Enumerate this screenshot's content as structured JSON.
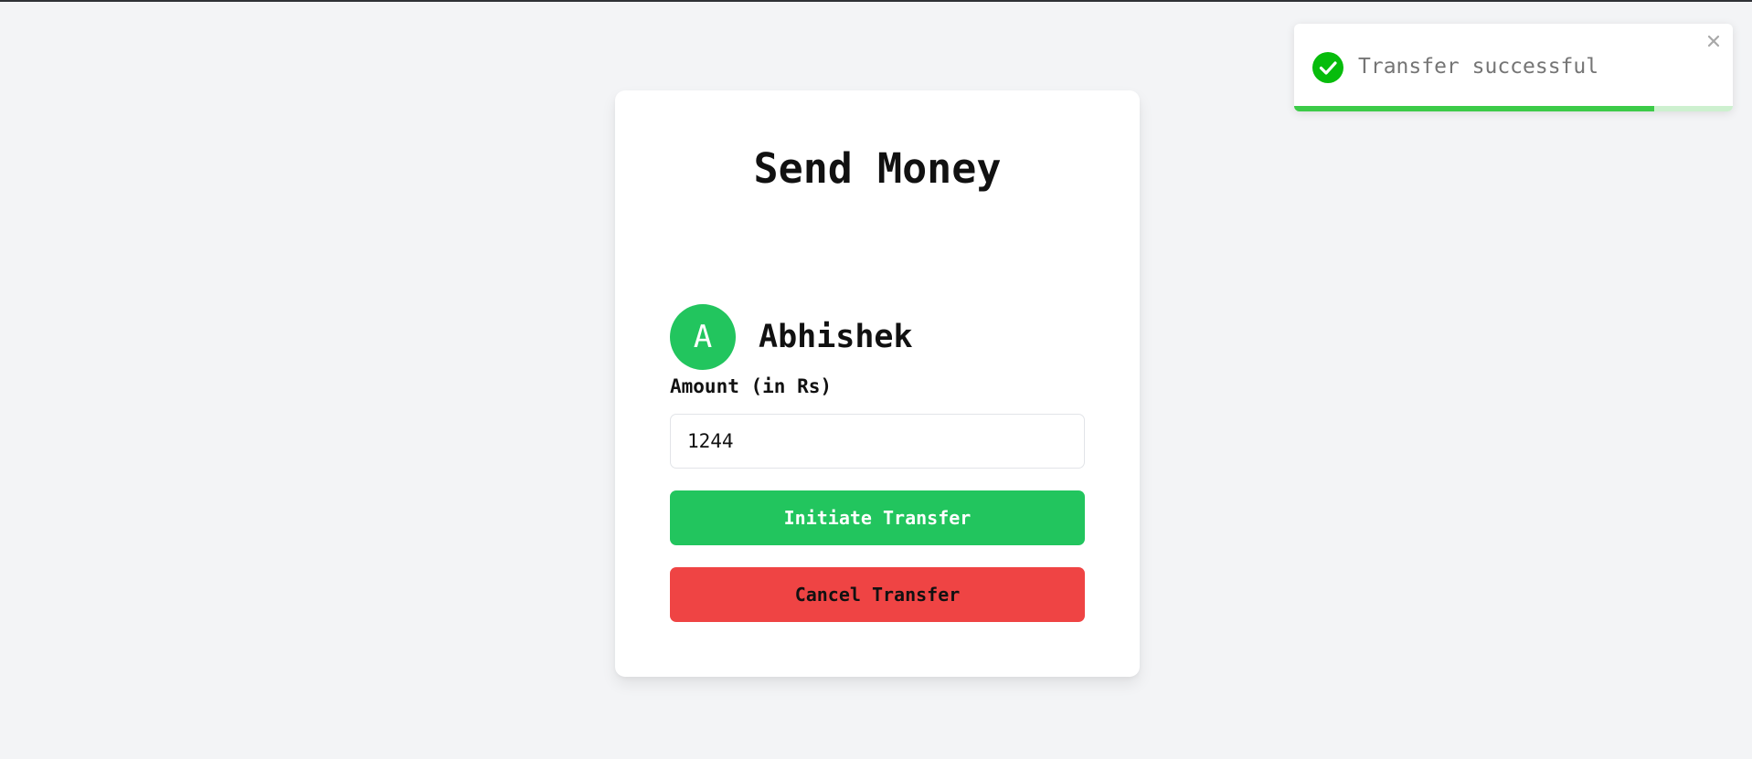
{
  "card": {
    "title": "Send Money",
    "recipient": {
      "initial": "A",
      "name": "Abhishek"
    },
    "amount": {
      "label": "Amount (in Rs)",
      "value": "1244"
    },
    "buttons": {
      "initiate_label": "Initiate Transfer",
      "cancel_label": "Cancel Transfer"
    }
  },
  "toast": {
    "message": "Transfer successful",
    "status": "success",
    "icon": "check-circle-icon",
    "close_icon": "close-icon",
    "progress_remaining": 0.82
  },
  "colors": {
    "accent_green": "#22c55e",
    "danger_red": "#ef4444",
    "toast_green": "#3ccb48",
    "background": "#f3f4f6"
  }
}
